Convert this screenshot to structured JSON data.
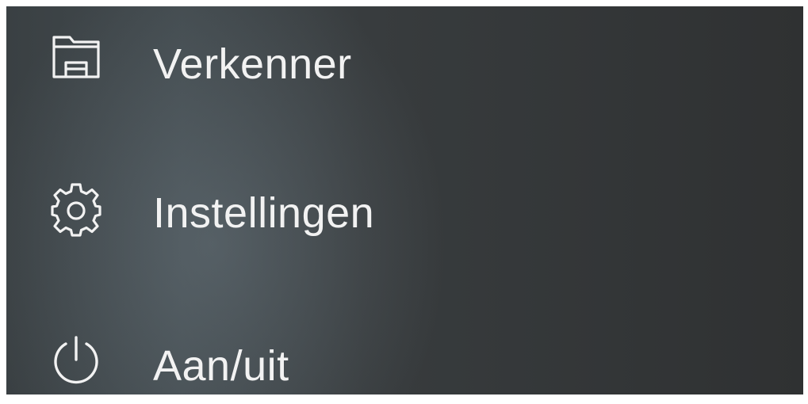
{
  "start_menu": {
    "items": [
      {
        "label": "Verkenner",
        "icon": "folder-icon"
      },
      {
        "label": "Instellingen",
        "icon": "gear-icon"
      },
      {
        "label": "Aan/uit",
        "icon": "power-icon"
      }
    ]
  },
  "colors": {
    "background": "#3a3f42",
    "text": "#f2f2f2"
  }
}
